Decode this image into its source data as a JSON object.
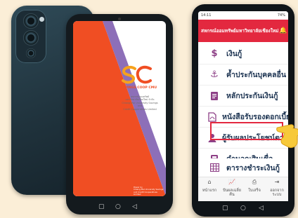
{
  "brand": {
    "logo_letters": "SC",
    "name": "SAVINGS COOP CMU",
    "lines": [
      "สหกรณ์ออมทรัพย์",
      "มหาวิทยาลัยเชียงใหม่ จำกัด",
      "Chiang Mai University Savings and",
      "Credit Cooperatives Limited"
    ],
    "footer": [
      "Power by",
      "Chiang Mai University Savings",
      "and Credit Cooperatives Limited"
    ],
    "colors": {
      "orange": "#f04e23",
      "purple": "#8d6fb8",
      "red": "#e3283f"
    }
  },
  "right_app": {
    "status_time": "14:11",
    "status_battery": "74%",
    "header_title": "สหกรณ์ออมทรัพย์มหาวิทยาลัยเชียงใหม่ จำกัด",
    "menu": [
      {
        "label": "เงินกู้",
        "icon": "dollar-icon"
      },
      {
        "label": "ค้ำประกันบุคคลอื่น",
        "icon": "anchor-icon"
      },
      {
        "label": "หลักประกันเงินกู้",
        "icon": "document-icon"
      },
      {
        "label": "หนังสือรับรองดอกเบี้ยเงิน",
        "icon": "pdf-file-icon"
      },
      {
        "label": "ผู้รับผลประโยชน์ตาม",
        "icon": "user-icon",
        "highlighted": true
      },
      {
        "label": "คำนวณสินเชื่อ",
        "icon": "calculator-icon"
      },
      {
        "label": "ตารางชำระเงินกู้",
        "icon": "table-icon"
      }
    ],
    "tabs": [
      {
        "label": "หน้าแรก",
        "icon": "home-icon"
      },
      {
        "label": "ปันผลเฉลี่ยคืน",
        "icon": "chart-icon"
      },
      {
        "label": "ใบเสร็จ",
        "icon": "printer-icon"
      },
      {
        "label": "ออกจากระบบ",
        "icon": "logout-icon"
      }
    ]
  }
}
